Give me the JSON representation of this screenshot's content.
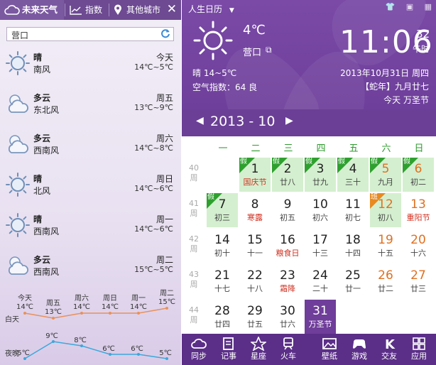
{
  "left": {
    "tabs": {
      "forecast": "未来天气",
      "index": "指数",
      "other": "其他城市"
    },
    "close": "✕",
    "city": "营口",
    "days": [
      {
        "cond": "晴",
        "wind": "南风",
        "day": "今天",
        "temp": "14℃~5℃",
        "icon": "sunny-icon"
      },
      {
        "cond": "多云",
        "wind": "东北风",
        "day": "周五",
        "temp": "13℃~9℃",
        "icon": "partly-cloudy-icon"
      },
      {
        "cond": "多云",
        "wind": "西南风",
        "day": "周六",
        "temp": "14℃~8℃",
        "icon": "partly-cloudy-icon"
      },
      {
        "cond": "晴",
        "wind": "北风",
        "day": "周日",
        "temp": "14℃~6℃",
        "icon": "sunny-icon"
      },
      {
        "cond": "晴",
        "wind": "西南风",
        "day": "周一",
        "temp": "14℃~6℃",
        "icon": "sunny-icon"
      },
      {
        "cond": "多云",
        "wind": "西南风",
        "day": "周二",
        "temp": "15℃~5℃",
        "icon": "partly-cloudy-icon"
      }
    ]
  },
  "chart_data": {
    "type": "line",
    "categories": [
      "今天",
      "周五",
      "周六",
      "周日",
      "周一",
      "周二"
    ],
    "series": [
      {
        "name": "白天",
        "values": [
          14,
          13,
          14,
          14,
          14,
          15
        ],
        "color": "#e8915a"
      },
      {
        "name": "夜晚",
        "values": [
          5,
          9,
          8,
          6,
          6,
          5
        ],
        "color": "#3aa8dc"
      }
    ],
    "unit": "℃"
  },
  "right": {
    "title": "人生日历",
    "weather": {
      "temp": "4℃",
      "city": "营口",
      "range": "晴 14~5℃",
      "aqi": "空气指数：64 良"
    },
    "clock": {
      "time": "11:06",
      "sec": "32",
      "ampm": "午时"
    },
    "date": "2013年10月31日 周四",
    "lunar": "【蛇年】九月廿七",
    "holiday": "今天 万圣节",
    "month": {
      "label": "2013 - 10",
      "prev": "◀",
      "next": "▶"
    },
    "weekdays": [
      "一",
      "二",
      "三",
      "四",
      "五",
      "六",
      "日"
    ],
    "weeks": [
      "40\n周",
      "41\n周",
      "42\n周",
      "43\n周",
      "44\n周"
    ],
    "cells": [
      [
        null,
        {
          "n": "1",
          "s": "国庆节",
          "g": true,
          "b": "假",
          "sr": true
        },
        {
          "n": "2",
          "s": "廿八",
          "g": true,
          "b": "假"
        },
        {
          "n": "3",
          "s": "廿九",
          "g": true,
          "b": "假"
        },
        {
          "n": "4",
          "s": "三十",
          "g": true,
          "b": "假"
        },
        {
          "n": "5",
          "s": "九月",
          "g": true,
          "b": "假",
          "w": true
        },
        {
          "n": "6",
          "s": "初二",
          "g": true,
          "b": "假",
          "w": true
        }
      ],
      [
        {
          "n": "7",
          "s": "初三",
          "g": true,
          "b": "假"
        },
        {
          "n": "8",
          "s": "寒露",
          "sr": true
        },
        {
          "n": "9",
          "s": "初五"
        },
        {
          "n": "10",
          "s": "初六"
        },
        {
          "n": "11",
          "s": "初七"
        },
        {
          "n": "12",
          "s": "初八",
          "g": true,
          "b": "班",
          "bo": true,
          "w": true
        },
        {
          "n": "13",
          "s": "重阳节",
          "w": true,
          "sr": true
        }
      ],
      [
        {
          "n": "14",
          "s": "初十"
        },
        {
          "n": "15",
          "s": "十一"
        },
        {
          "n": "16",
          "s": "粮食日",
          "sr": true
        },
        {
          "n": "17",
          "s": "十三"
        },
        {
          "n": "18",
          "s": "十四"
        },
        {
          "n": "19",
          "s": "十五",
          "w": true
        },
        {
          "n": "20",
          "s": "十六",
          "w": true
        }
      ],
      [
        {
          "n": "21",
          "s": "十七"
        },
        {
          "n": "22",
          "s": "十八"
        },
        {
          "n": "23",
          "s": "霜降",
          "sr": true
        },
        {
          "n": "24",
          "s": "二十"
        },
        {
          "n": "25",
          "s": "廿一"
        },
        {
          "n": "26",
          "s": "廿二",
          "w": true
        },
        {
          "n": "27",
          "s": "廿三",
          "w": true
        }
      ],
      [
        {
          "n": "28",
          "s": "廿四"
        },
        {
          "n": "29",
          "s": "廿五"
        },
        {
          "n": "30",
          "s": "廿六"
        },
        {
          "n": "31",
          "s": "万圣节",
          "sel": true
        },
        null,
        null,
        null
      ]
    ],
    "footer": [
      {
        "label": "同步",
        "icon": "cloud-icon"
      },
      {
        "label": "记事",
        "icon": "notepad-icon"
      },
      {
        "label": "星座",
        "icon": "zodiac-icon"
      },
      {
        "label": "火车",
        "icon": "train-icon"
      },
      {
        "label": "壁纸",
        "icon": "wallpaper-icon"
      },
      {
        "label": "游戏",
        "icon": "gamepad-icon"
      },
      {
        "label": "交友",
        "icon": "kaixin-icon"
      },
      {
        "label": "应用",
        "icon": "apps-icon"
      }
    ]
  }
}
